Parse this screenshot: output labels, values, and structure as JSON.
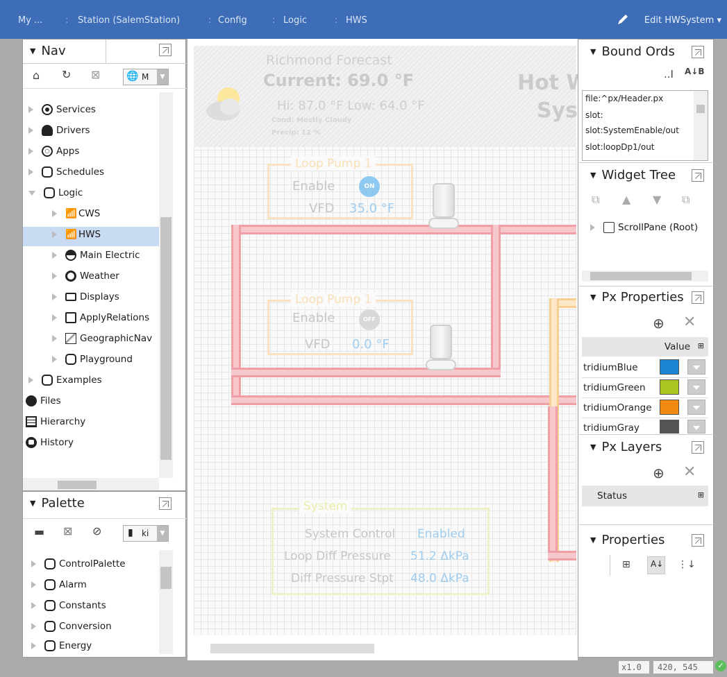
{
  "breadcrumb": {
    "items": [
      "My ...",
      "Station (SalemStation)",
      "Config",
      "Logic",
      "HWS"
    ],
    "separator": ":",
    "edit_label": "Edit HWSystem"
  },
  "nav": {
    "title": "Nav",
    "toolbar_dropdown": "M",
    "items": [
      {
        "label": "Services",
        "icon": "gear-icon",
        "expanded": false
      },
      {
        "label": "Drivers",
        "icon": "driver-icon",
        "expanded": false
      },
      {
        "label": "Apps",
        "icon": "apps-icon",
        "expanded": false
      },
      {
        "label": "Schedules",
        "icon": "folder-icon",
        "expanded": false
      },
      {
        "label": "Logic",
        "icon": "folder-icon",
        "expanded": true
      },
      {
        "label": "CWS",
        "icon": "tower-icon",
        "expanded": false
      },
      {
        "label": "HWS",
        "icon": "tower-icon",
        "expanded": false,
        "selected": true
      },
      {
        "label": "Main Electric",
        "icon": "meter-icon",
        "expanded": false
      },
      {
        "label": "Weather",
        "icon": "weather-icon",
        "expanded": false
      },
      {
        "label": "Displays",
        "icon": "monitor-icon",
        "expanded": false
      },
      {
        "label": "ApplyRelations",
        "icon": "relations-icon",
        "expanded": false
      },
      {
        "label": "GeographicNav",
        "icon": "map-icon",
        "expanded": false
      },
      {
        "label": "Playground",
        "icon": "folder-icon",
        "expanded": false
      },
      {
        "label": "Examples",
        "icon": "folder-icon",
        "expanded": false
      },
      {
        "label": "Files",
        "icon": "files-icon"
      },
      {
        "label": "Hierarchy",
        "icon": "hierarchy-icon"
      },
      {
        "label": "History",
        "icon": "history-icon"
      }
    ]
  },
  "palette": {
    "title": "Palette",
    "dropdown": "ki",
    "items": [
      "ControlPalette",
      "Alarm",
      "Constants",
      "Conversion",
      "Energy"
    ]
  },
  "canvas": {
    "forecast_title": "Richmond Forecast",
    "current": "Current: 69.0 °F",
    "hilo": "Hi: 87.0 °F  Low: 64.0 °F",
    "cond": "Cond: Mostly Cloudy",
    "precip": "Precip: 12 %",
    "system_title_1": "Hot W",
    "system_title_2": "Syst",
    "pump1": {
      "title": "Loop Pump 1",
      "enable_label": "Enable",
      "state": "ON",
      "vfd_label": "VFD",
      "vfd_value": "35.0 °F"
    },
    "pump2": {
      "title": "Loop Pump 1",
      "enable_label": "Enable",
      "state": "OFF",
      "vfd_label": "VFD",
      "vfd_value": "0.0 °F"
    },
    "system": {
      "title": "System",
      "rows": [
        {
          "label": "System Control",
          "value": "Enabled"
        },
        {
          "label": "Loop Diff Pressure",
          "value": "51.2 ΔkPa"
        },
        {
          "label": "Diff Pressure Stpt",
          "value": "48.0 ΔkPa"
        }
      ]
    }
  },
  "bound_ords": {
    "title": "Bound Ords",
    "items": [
      "file:^px/Header.px",
      "slot:",
      "slot:SystemEnable/out",
      "slot:loopDp1/out"
    ]
  },
  "widget_tree": {
    "title": "Widget Tree",
    "root": "ScrollPane (Root)"
  },
  "px_properties": {
    "title": "Px Properties",
    "column": "Value",
    "rows": [
      {
        "name": "tridiumBlue",
        "color": "#1a86d3"
      },
      {
        "name": "tridiumGreen",
        "color": "#a8c61f"
      },
      {
        "name": "tridiumOrange",
        "color": "#ef8a0e"
      },
      {
        "name": "tridiumGray",
        "color": "#555555"
      }
    ]
  },
  "px_layers": {
    "title": "Px Layers",
    "column": "Status"
  },
  "properties": {
    "title": "Properties"
  },
  "status": {
    "zoom": "x1.0",
    "coords": "420, 545"
  },
  "colors": {
    "topbar": "#3d6db6",
    "selection": "#c9daf3",
    "pipe": "#f7c8cb",
    "value_blue": "#9fcdf0"
  }
}
